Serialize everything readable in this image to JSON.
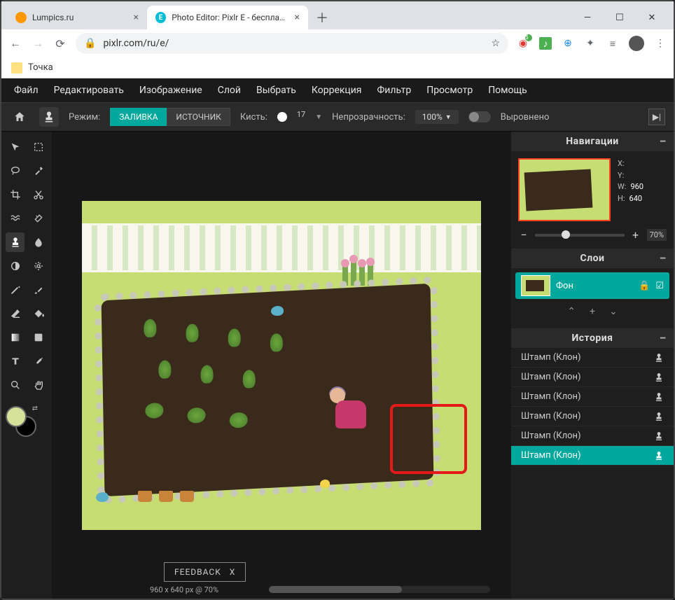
{
  "browser": {
    "tabs": [
      {
        "favicon_color": "#ff9800",
        "title": "Lumpics.ru"
      },
      {
        "favicon_color": "#00bcd4",
        "favicon_text": "E",
        "title": "Photo Editor: Pixlr E - бесплатны"
      }
    ],
    "url": "pixlr.com/ru/e/",
    "bookmark": "Точка"
  },
  "menubar": [
    "Файл",
    "Редактировать",
    "Изображение",
    "Слой",
    "Выбрать",
    "Коррекция",
    "Фильтр",
    "Просмотр",
    "Помощь"
  ],
  "optbar": {
    "mode_label": "Режим:",
    "mode_fill": "ЗАЛИВКА",
    "mode_source": "ИСТОЧНИК",
    "brush_label": "Кисть:",
    "brush_size": "17",
    "opacity_label": "Непрозрачность:",
    "opacity_value": "100%",
    "aligned_label": "Выровнено"
  },
  "status_text": "960 x 640 px @ 70%",
  "feedback": {
    "label": "FEEDBACK",
    "close": "X"
  },
  "panels": {
    "nav": {
      "title": "Навигации",
      "x_label": "X:",
      "y_label": "Y:",
      "w_label": "W:",
      "w_value": "960",
      "h_label": "H:",
      "h_value": "640",
      "zoom_value": "70%"
    },
    "layers": {
      "title": "Слои",
      "bg_name": "Фон"
    },
    "history": {
      "title": "История",
      "items": [
        "Штамп (Клон)",
        "Штамп (Клон)",
        "Штамп (Клон)",
        "Штамп (Клон)",
        "Штамп (Клон)",
        "Штамп (Клон)"
      ]
    }
  }
}
